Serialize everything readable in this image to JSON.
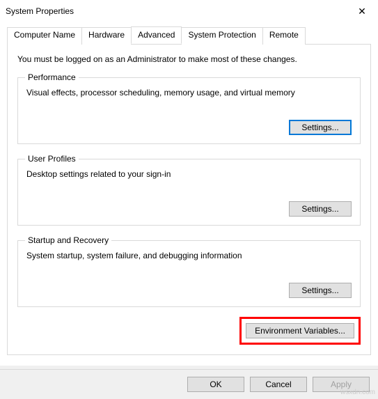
{
  "window": {
    "title": "System Properties",
    "close": "✕"
  },
  "tabs": {
    "computer_name": "Computer Name",
    "hardware": "Hardware",
    "advanced": "Advanced",
    "system_protection": "System Protection",
    "remote": "Remote"
  },
  "advanced": {
    "intro": "You must be logged on as an Administrator to make most of these changes.",
    "performance": {
      "legend": "Performance",
      "desc": "Visual effects, processor scheduling, memory usage, and virtual memory",
      "settings_btn": "Settings..."
    },
    "user_profiles": {
      "legend": "User Profiles",
      "desc": "Desktop settings related to your sign-in",
      "settings_btn": "Settings..."
    },
    "startup_recovery": {
      "legend": "Startup and Recovery",
      "desc": "System startup, system failure, and debugging information",
      "settings_btn": "Settings..."
    },
    "env_vars_btn": "Environment Variables..."
  },
  "footer": {
    "ok": "OK",
    "cancel": "Cancel",
    "apply": "Apply"
  },
  "watermark": "wsxdn.com"
}
